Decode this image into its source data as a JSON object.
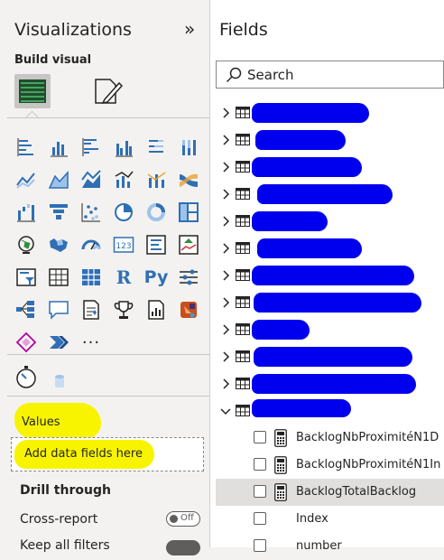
{
  "visualizations": {
    "title": "Visualizations",
    "build_visual_label": "Build visual",
    "values_label": "Values",
    "dropzone_text": "Add data fields here",
    "drill_through_label": "Drill through",
    "cross_report_label": "Cross-report",
    "cross_report_toggle": "Off",
    "keep_filters_label": "Keep all filters",
    "more_label": "···",
    "r_label": "R",
    "py_label": "Py",
    "card_label": "123"
  },
  "fields": {
    "title": "Fields",
    "search_placeholder": "Search",
    "tables_count_visible": 12,
    "expanded_table_fields": [
      {
        "label": "BacklogNbProximitéN1D",
        "type": "measure"
      },
      {
        "label": "BacklogNbProximitéN1In",
        "type": "measure"
      },
      {
        "label": "BacklogTotalBacklog",
        "type": "measure",
        "selected": true
      },
      {
        "label": "Index",
        "type": "column"
      },
      {
        "label": "number",
        "type": "column"
      }
    ]
  },
  "colors": {
    "highlight": "#f8f400",
    "redaction": "#0000ee",
    "selected_row": "#e1dfdd"
  }
}
